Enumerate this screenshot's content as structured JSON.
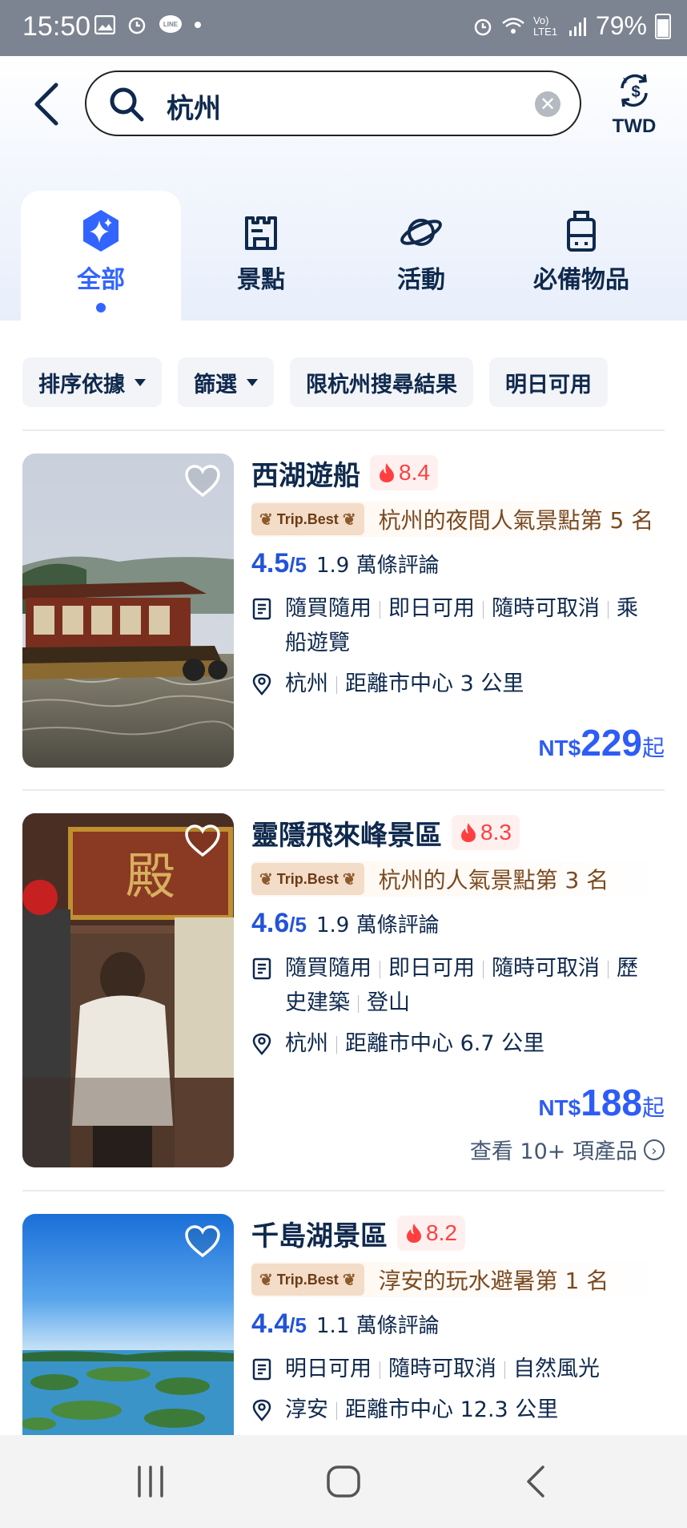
{
  "status": {
    "time": "15:50",
    "battery": "79%",
    "network": "Vo) LTE1",
    "left_icons": [
      "image-icon",
      "alarm-icon",
      "line-icon",
      "dot-icon"
    ],
    "right_icons": [
      "alarm-icon",
      "wifi-icon",
      "signal-icon",
      "battery-icon"
    ]
  },
  "search": {
    "value": "杭州"
  },
  "currency": {
    "label": "TWD"
  },
  "tabs": [
    {
      "label": "全部",
      "icon": "sparkle-icon",
      "active": true
    },
    {
      "label": "景點",
      "icon": "castle-icon",
      "active": false
    },
    {
      "label": "活動",
      "icon": "planet-icon",
      "active": false
    },
    {
      "label": "必備物品",
      "icon": "luggage-icon",
      "active": false
    }
  ],
  "filters": [
    {
      "label": "排序依據"
    },
    {
      "label": "篩選"
    },
    {
      "label": "限杭州搜尋結果"
    },
    {
      "label": "明日可用"
    }
  ],
  "cards": [
    {
      "title": "西湖遊船",
      "heat": "8.4",
      "badge": "Trip.Best",
      "rank": "杭州的夜間人氣景點第 5 名",
      "score": "4.5",
      "score_max": "/5",
      "reviews": "1.9 萬條評論",
      "tags_line1": [
        "隨買隨用",
        "即日可用",
        "隨時可取消",
        "乘"
      ],
      "tags_line2": [
        "船遊覽"
      ],
      "location": "杭州",
      "distance": "距離市中心 3 公里",
      "price_currency": "NT$",
      "price": "229",
      "price_suffix": "起"
    },
    {
      "title": "靈隱飛來峰景區",
      "heat": "8.3",
      "badge": "Trip.Best",
      "rank": "杭州的人氣景點第 3 名",
      "score": "4.6",
      "score_max": "/5",
      "reviews": "1.9 萬條評論",
      "tags_line1": [
        "隨買隨用",
        "即日可用",
        "隨時可取消",
        "歷"
      ],
      "tags_line2": [
        "史建築",
        "登山"
      ],
      "location": "杭州",
      "distance": "距離市中心 6.7 公里",
      "price_currency": "NT$",
      "price": "188",
      "price_suffix": "起",
      "more": "查看 10+ 項產品"
    },
    {
      "title": "千島湖景區",
      "heat": "8.2",
      "badge": "Trip.Best",
      "rank": "淳安的玩水避暑第 1 名",
      "score": "4.4",
      "score_max": "/5",
      "reviews": "1.1 萬條評論",
      "tags_line1": [
        "明日可用",
        "隨時可取消",
        "自然風光"
      ],
      "location": "淳安",
      "distance": "距離市中心 12.3 公里"
    }
  ],
  "colors": {
    "accent": "#3264ff",
    "price": "#2e5cf6",
    "heat": "#ff3f3f",
    "navy": "#0f294d"
  }
}
